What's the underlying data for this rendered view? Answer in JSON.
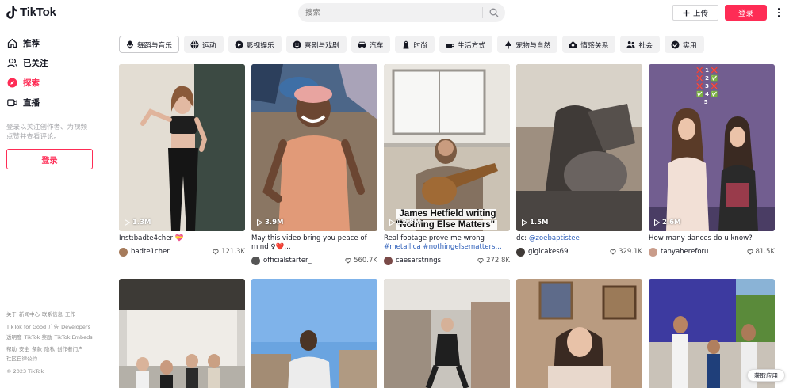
{
  "header": {
    "logo_text": "TikTok",
    "search_placeholder": "搜索",
    "upload_label": "上传",
    "login_label": "登录"
  },
  "sidebar": {
    "nav": [
      {
        "label": "推荐",
        "icon": "home-icon"
      },
      {
        "label": "已关注",
        "icon": "following-icon"
      },
      {
        "label": "探索",
        "icon": "explore-icon"
      },
      {
        "label": "直播",
        "icon": "live-icon"
      }
    ],
    "login_tip": "登录以关注创作者、为视频点赞并查看评论。",
    "login_button": "登录",
    "footer": {
      "row1": [
        "关于",
        "新闻中心",
        "联系信息",
        "工作"
      ],
      "row2": [
        "TikTok for Good",
        "广告",
        "Developers"
      ],
      "row3": [
        "透明度",
        "TikTok 奖励",
        "TikTok Embeds"
      ],
      "row4": [
        "帮助",
        "安全",
        "条款",
        "隐私",
        "创作者门户"
      ],
      "row5": [
        "社区自律公约"
      ],
      "copyright": "© 2023 TikTok"
    }
  },
  "categories": [
    {
      "label": "舞蹈与音乐",
      "icon": "microphone-icon",
      "active": true
    },
    {
      "label": "运动",
      "icon": "sports-icon"
    },
    {
      "label": "影视娱乐",
      "icon": "film-icon"
    },
    {
      "label": "喜剧与戏剧",
      "icon": "comedy-icon"
    },
    {
      "label": "汽车",
      "icon": "car-icon"
    },
    {
      "label": "时尚",
      "icon": "fashion-icon"
    },
    {
      "label": "生活方式",
      "icon": "lifestyle-icon"
    },
    {
      "label": "宠物与自然",
      "icon": "nature-icon"
    },
    {
      "label": "情感关系",
      "icon": "relationship-icon"
    },
    {
      "label": "社会",
      "icon": "society-icon"
    },
    {
      "label": "实用",
      "icon": "practical-icon"
    }
  ],
  "videos": [
    {
      "views": "1.3M",
      "caption": "Inst:badte4cher 💝",
      "author": "badte1cher",
      "likes": "121.3K"
    },
    {
      "views": "3.9M",
      "caption": "May this video bring you peace of mind ♀❤️...",
      "author": "officialstarter_",
      "likes": "560.7K"
    },
    {
      "views": "12.8M",
      "caption": "Real footage prove me wrong",
      "tags": "#metallica #nothingelsematters...",
      "author": "caesarstrings",
      "likes": "272.8K",
      "overlay": "James Hetfield writing \"Nothing Else Matters\""
    },
    {
      "views": "1.5M",
      "caption": "dc: ",
      "mention": "@zoebaptistee",
      "author": "gigicakes69",
      "likes": "329.1K"
    },
    {
      "views": "2.6M",
      "caption": "How many dances do u know?",
      "author": "tanyahereforu",
      "likes": "81.5K",
      "checklist": [
        "1",
        "2",
        "3",
        "4",
        "5"
      ]
    }
  ],
  "get_app_label": "获取应用",
  "colors": {
    "brand": "#fe2c55",
    "text": "#161823",
    "link": "#2b5db9"
  }
}
